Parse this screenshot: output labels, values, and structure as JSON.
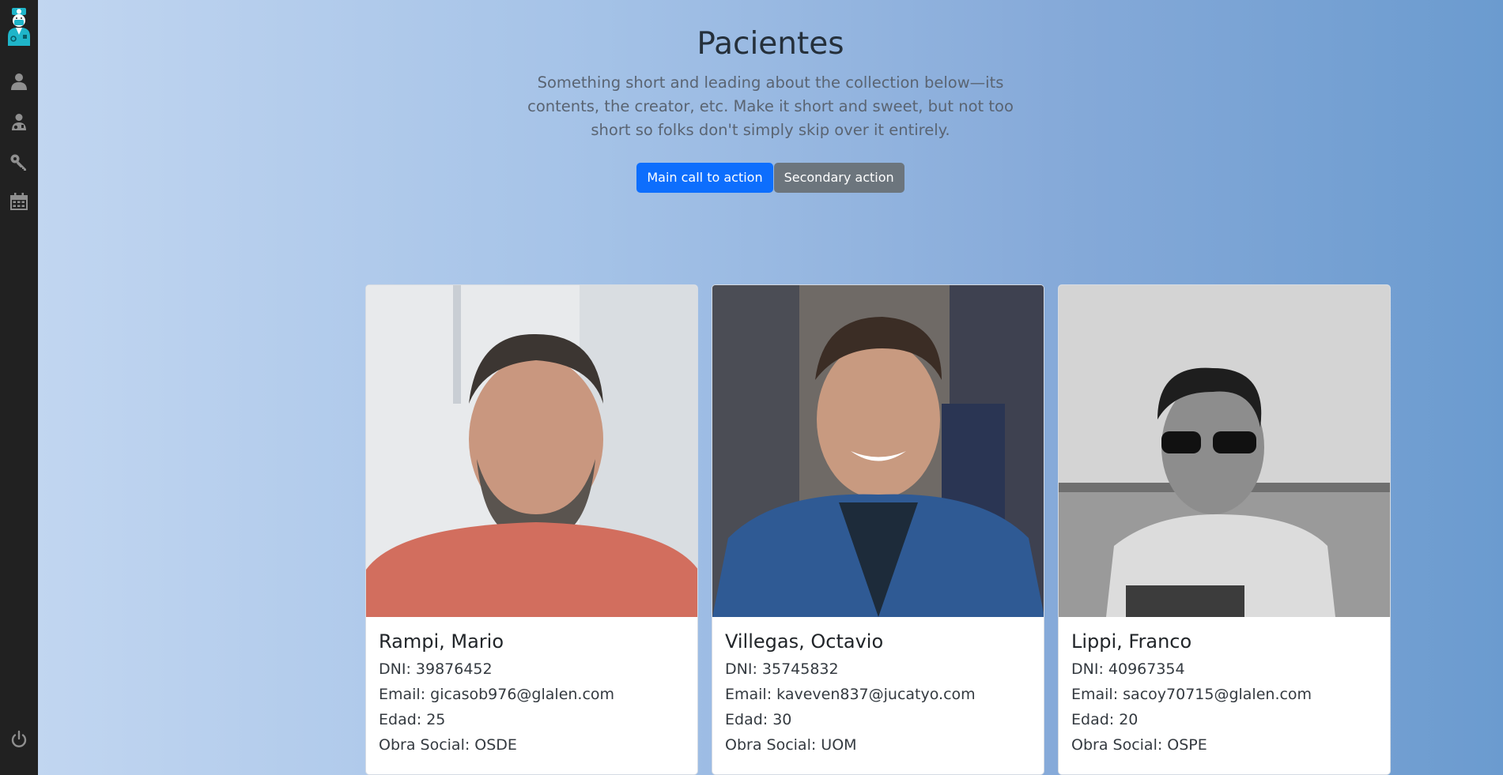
{
  "sidebar": {
    "logo": "doctor-logo-icon",
    "items": [
      {
        "icon": "user-icon"
      },
      {
        "icon": "doctor-icon"
      },
      {
        "icon": "key-icon"
      },
      {
        "icon": "calendar-icon"
      }
    ],
    "footer": {
      "icon": "power-icon"
    }
  },
  "hero": {
    "title": "Pacientes",
    "lead": "Something short and leading about the collection below—its contents, the creator, etc. Make it short and sweet, but not too short so folks don't simply skip over it entirely.",
    "primary_action": "Main call to action",
    "secondary_action": "Secondary action"
  },
  "patients": [
    {
      "name": "Rampi, Mario",
      "dni": "DNI: 39876452",
      "email": "Email: gicasob976@glalen.com",
      "edad": "Edad: 25",
      "obra_social": "Obra Social: OSDE"
    },
    {
      "name": "Villegas, Octavio",
      "dni": "DNI: 35745832",
      "email": "Email: kaveven837@jucatyo.com",
      "edad": "Edad: 30",
      "obra_social": "Obra Social: UOM"
    },
    {
      "name": "Lippi, Franco",
      "dni": "DNI: 40967354",
      "email": "Email: sacoy70715@glalen.com",
      "edad": "Edad: 20",
      "obra_social": "Obra Social: OSPE"
    }
  ],
  "colors": {
    "sidebar": "#212121",
    "primary": "#0d6efd",
    "secondary": "#6c757d",
    "icon": "#8f8f8f"
  }
}
